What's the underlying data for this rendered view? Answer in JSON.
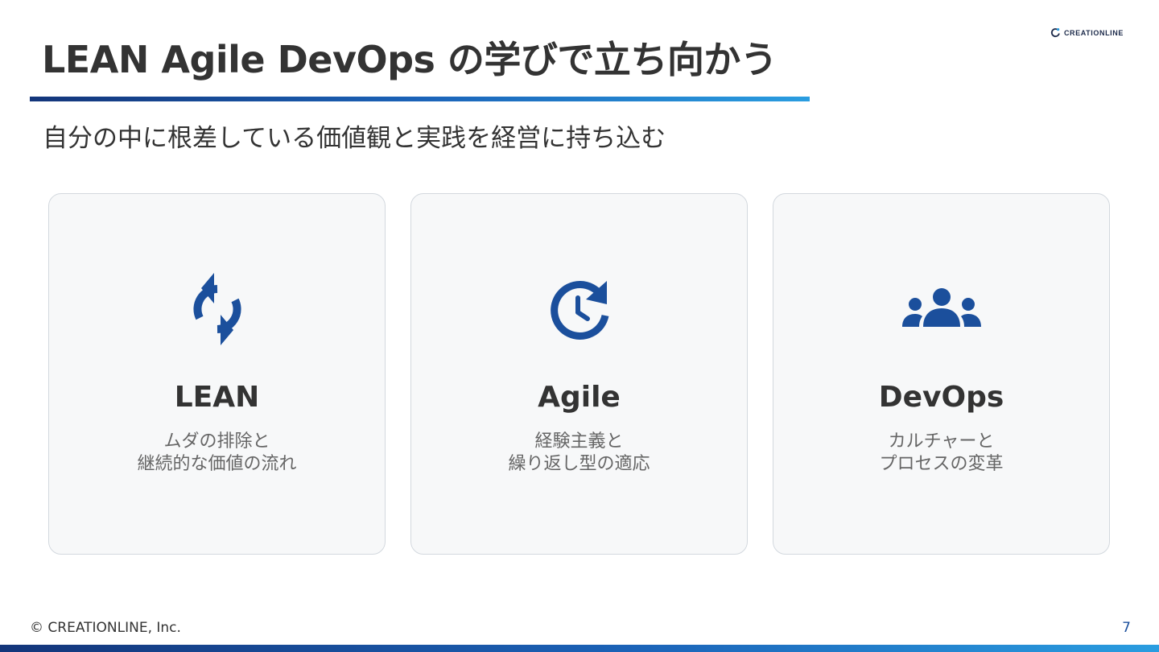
{
  "slide": {
    "title": "LEAN Agile DevOps の学びで立ち向かう",
    "subtitle": "自分の中に根差している価値観と実践を経営に持ち込む",
    "logo_text": "CREATIONLINE",
    "accent_color": "#1b4f9c"
  },
  "cards": [
    {
      "icon": "sync-icon",
      "title": "LEAN",
      "desc_line1": "ムダの排除と",
      "desc_line2": "継続的な価値の流れ"
    },
    {
      "icon": "clock-refresh-icon",
      "title": "Agile",
      "desc_line1": "経験主義と",
      "desc_line2": "繰り返し型の適応"
    },
    {
      "icon": "people-group-icon",
      "title": "DevOps",
      "desc_line1": "カルチャーと",
      "desc_line2": "プロセスの変革"
    }
  ],
  "footer": {
    "copyright": "© CREATIONLINE, Inc.",
    "page_number": "7"
  }
}
